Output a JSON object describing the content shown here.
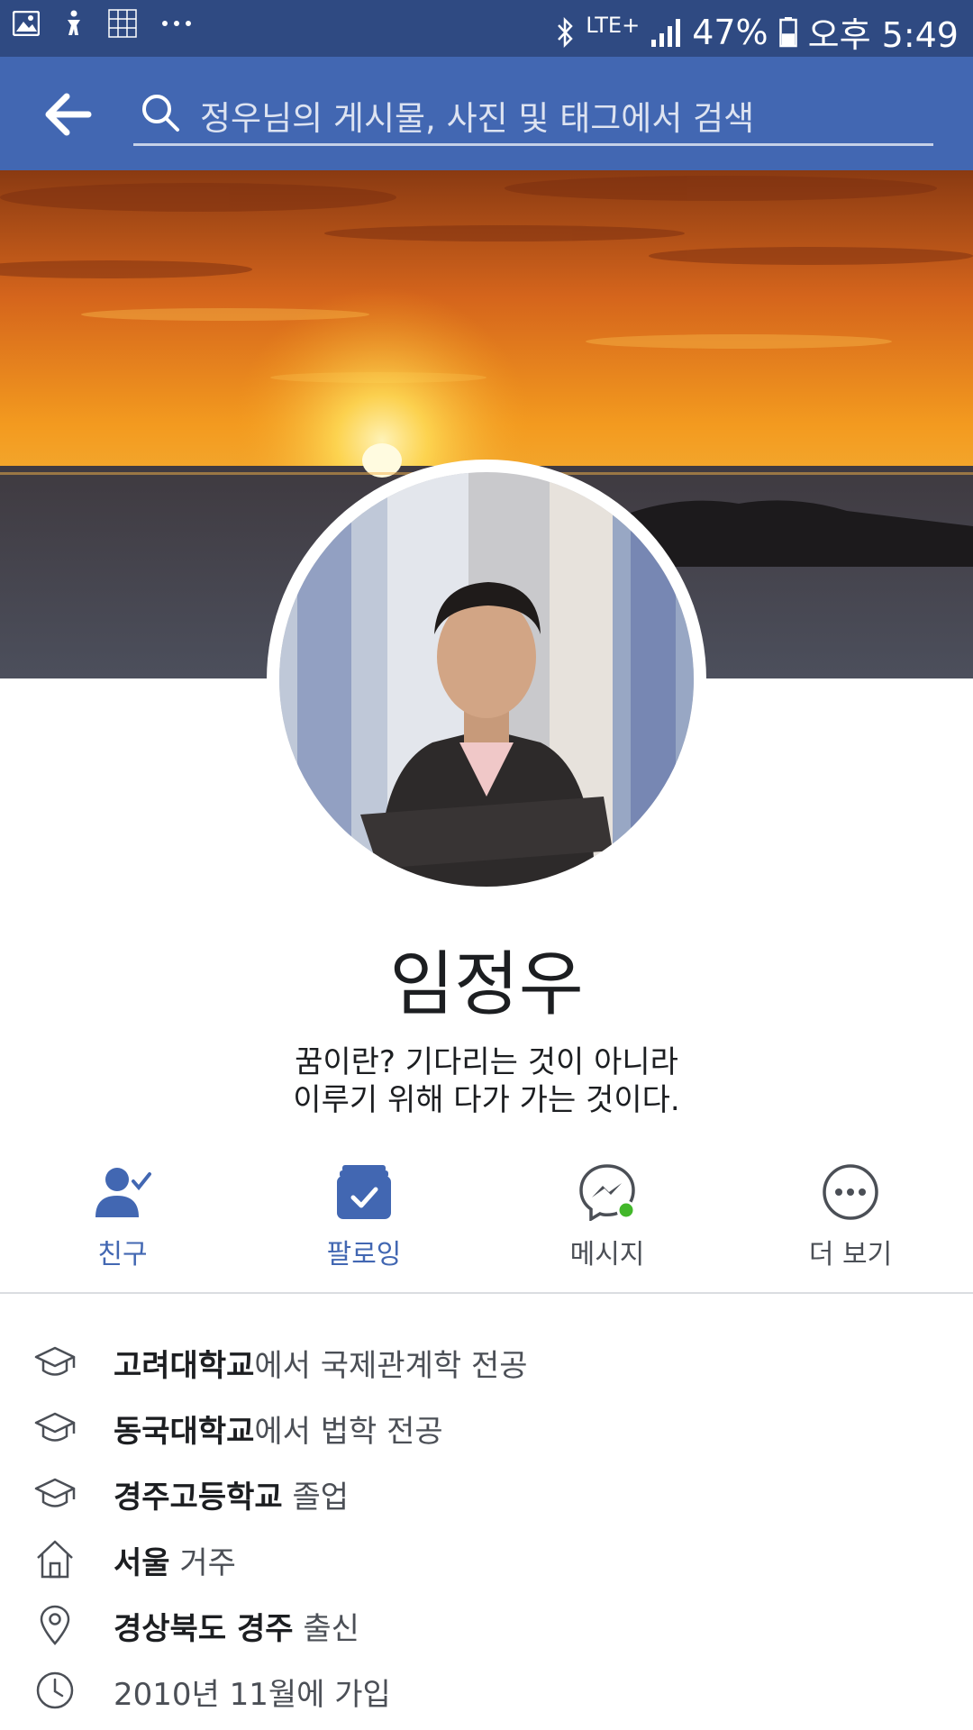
{
  "status_bar": {
    "lte": "LTE+",
    "battery_percent": "47%",
    "time": "오후 5:49",
    "icons": [
      "gallery-icon",
      "accessibility-icon",
      "numpad-icon",
      "more-dots-icon",
      "bluetooth-icon",
      "signal-icon",
      "battery-icon"
    ],
    "battery_level": 0.47
  },
  "header": {
    "search_placeholder": "정우님의 게시물, 사진 및 태그에서 검색",
    "colors": {
      "bar": "#4267b2",
      "status": "#2f4a82"
    }
  },
  "profile": {
    "name": "임정우",
    "bio_line1": "꿈이란? 기다리는 것이 아니라",
    "bio_line2": "이루기 위해 다가 가는 것이다."
  },
  "actions": [
    {
      "label": "친구",
      "icon": "friends-check-icon",
      "active": true
    },
    {
      "label": "팔로잉",
      "icon": "following-check-icon",
      "active": true
    },
    {
      "label": "메시지",
      "icon": "messenger-icon",
      "active": false
    },
    {
      "label": "더 보기",
      "icon": "more-icon",
      "active": false
    }
  ],
  "info": [
    {
      "icon": "graduation-cap-icon",
      "strong": "고려대학교",
      "rest": "에서 국제관계학 전공"
    },
    {
      "icon": "graduation-cap-icon",
      "strong": "동국대학교",
      "rest": "에서 법학 전공"
    },
    {
      "icon": "graduation-cap-icon",
      "strong": "경주고등학교",
      "rest": " 졸업"
    },
    {
      "icon": "home-icon",
      "strong": "서울",
      "rest": " 거주"
    },
    {
      "icon": "location-pin-icon",
      "strong": "경상북도 경주",
      "rest": " 출신"
    },
    {
      "icon": "clock-icon",
      "strong": "",
      "rest": "2010년 11월에 가입"
    }
  ]
}
